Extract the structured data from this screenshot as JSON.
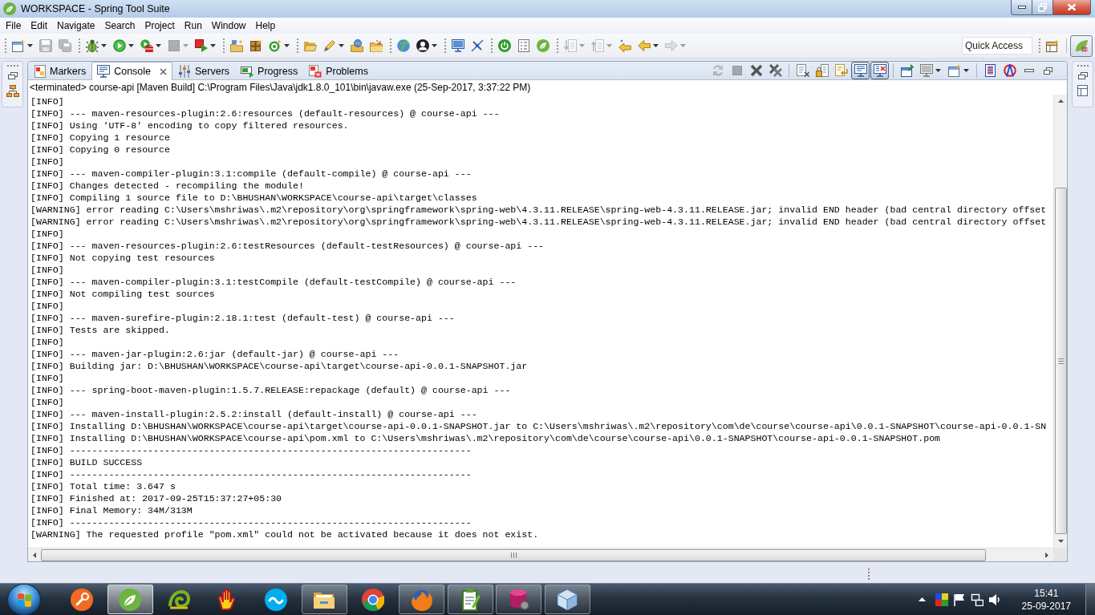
{
  "window": {
    "title": "WORKSPACE - Spring Tool Suite"
  },
  "menu": [
    {
      "label": "File"
    },
    {
      "label": "Edit"
    },
    {
      "label": "Navigate"
    },
    {
      "label": "Search"
    },
    {
      "label": "Project"
    },
    {
      "label": "Run"
    },
    {
      "label": "Window"
    },
    {
      "label": "Help"
    }
  ],
  "toolbar": {
    "buttons": [
      {
        "disabled": false
      },
      {
        "disabled": true
      },
      {
        "disabled": true
      },
      {
        "disabled": false
      },
      {
        "disabled": false
      },
      {
        "disabled": false
      },
      {
        "disabled": true
      },
      {
        "disabled": false
      },
      {
        "disabled": false
      },
      {
        "disabled": false
      },
      {
        "disabled": false
      },
      {
        "disabled": false
      },
      {
        "disabled": false
      },
      {
        "disabled": false
      },
      {
        "disabled": false
      },
      {
        "disabled": false
      },
      {
        "disabled": false
      },
      {
        "disabled": false
      },
      {
        "disabled": false
      },
      {
        "disabled": false
      },
      {
        "disabled": false
      },
      {
        "disabled": false
      },
      {
        "disabled": true
      },
      {
        "disabled": true
      },
      {
        "disabled": false
      },
      {
        "disabled": false
      },
      {
        "disabled": true
      }
    ],
    "quick_access": {
      "placeholder": "Quick Access"
    },
    "perspective": {
      "selected": true
    }
  },
  "view": {
    "tabs": [
      {
        "label": "Markers",
        "selected": false
      },
      {
        "label": "Console",
        "selected": true
      },
      {
        "label": "Servers",
        "selected": false
      },
      {
        "label": "Progress",
        "selected": false
      },
      {
        "label": "Problems",
        "selected": false
      }
    ],
    "toolbar": [
      {
        "disabled": true,
        "pressed": false
      },
      {
        "disabled": true,
        "pressed": false
      },
      {
        "disabled": false,
        "pressed": false
      },
      {
        "disabled": false,
        "pressed": false
      },
      {
        "disabled": false,
        "pressed": false
      },
      {
        "disabled": false,
        "pressed": false
      },
      {
        "disabled": false,
        "pressed": false
      },
      {
        "disabled": false,
        "pressed": true
      },
      {
        "disabled": false,
        "pressed": true
      },
      {
        "disabled": false,
        "pressed": false
      },
      {
        "disabled": false,
        "pressed": false
      },
      {
        "disabled": false,
        "pressed": false
      },
      {
        "disabled": false,
        "pressed": false
      },
      {
        "disabled": false,
        "pressed": false
      }
    ]
  },
  "console": {
    "description": "<terminated> course-api [Maven Build] C:\\Program Files\\Java\\jdk1.8.0_101\\bin\\javaw.exe (25-Sep-2017, 3:37:22 PM)",
    "lines": [
      "[INFO]",
      "[INFO] --- maven-resources-plugin:2.6:resources (default-resources) @ course-api ---",
      "[INFO] Using 'UTF-8' encoding to copy filtered resources.",
      "[INFO] Copying 1 resource",
      "[INFO] Copying 0 resource",
      "[INFO]",
      "[INFO] --- maven-compiler-plugin:3.1:compile (default-compile) @ course-api ---",
      "[INFO] Changes detected - recompiling the module!",
      "[INFO] Compiling 1 source file to D:\\BHUSHAN\\WORKSPACE\\course-api\\target\\classes",
      "[WARNING] error reading C:\\Users\\mshriwas\\.m2\\repository\\org\\springframework\\spring-web\\4.3.11.RELEASE\\spring-web-4.3.11.RELEASE.jar; invalid END header (bad central directory offset",
      "[WARNING] error reading C:\\Users\\mshriwas\\.m2\\repository\\org\\springframework\\spring-web\\4.3.11.RELEASE\\spring-web-4.3.11.RELEASE.jar; invalid END header (bad central directory offset",
      "[INFO]",
      "[INFO] --- maven-resources-plugin:2.6:testResources (default-testResources) @ course-api ---",
      "[INFO] Not copying test resources",
      "[INFO]",
      "[INFO] --- maven-compiler-plugin:3.1:testCompile (default-testCompile) @ course-api ---",
      "[INFO] Not compiling test sources",
      "[INFO]",
      "[INFO] --- maven-surefire-plugin:2.18.1:test (default-test) @ course-api ---",
      "[INFO] Tests are skipped.",
      "[INFO]",
      "[INFO] --- maven-jar-plugin:2.6:jar (default-jar) @ course-api ---",
      "[INFO] Building jar: D:\\BHUSHAN\\WORKSPACE\\course-api\\target\\course-api-0.0.1-SNAPSHOT.jar",
      "[INFO]",
      "[INFO] --- spring-boot-maven-plugin:1.5.7.RELEASE:repackage (default) @ course-api ---",
      "[INFO]",
      "[INFO] --- maven-install-plugin:2.5.2:install (default-install) @ course-api ---",
      "[INFO] Installing D:\\BHUSHAN\\WORKSPACE\\course-api\\target\\course-api-0.0.1-SNAPSHOT.jar to C:\\Users\\mshriwas\\.m2\\repository\\com\\de\\course\\course-api\\0.0.1-SNAPSHOT\\course-api-0.0.1-SN",
      "[INFO] Installing D:\\BHUSHAN\\WORKSPACE\\course-api\\pom.xml to C:\\Users\\mshriwas\\.m2\\repository\\com\\de\\course\\course-api\\0.0.1-SNAPSHOT\\course-api-0.0.1-SNAPSHOT.pom",
      "[INFO] ------------------------------------------------------------------------",
      "[INFO] BUILD SUCCESS",
      "[INFO] ------------------------------------------------------------------------",
      "[INFO] Total time: 3.647 s",
      "[INFO] Finished at: 2017-09-25T15:37:27+05:30",
      "[INFO] Final Memory: 34M/313M",
      "[INFO] ------------------------------------------------------------------------",
      "[WARNING] The requested profile \"pom.xml\" could not be activated because it does not exist."
    ]
  },
  "taskbar": {
    "apps": [
      {
        "running": false,
        "selected": false
      },
      {
        "running": true,
        "selected": true
      },
      {
        "running": false,
        "selected": false
      },
      {
        "running": false,
        "selected": false
      },
      {
        "running": false,
        "selected": false
      },
      {
        "running": true,
        "selected": false
      },
      {
        "running": false,
        "selected": false
      },
      {
        "running": true,
        "selected": false
      },
      {
        "running": true,
        "selected": false
      },
      {
        "running": true,
        "selected": false
      },
      {
        "running": true,
        "selected": false
      }
    ],
    "clock": {
      "time": "15:41",
      "date": "25-09-2017"
    }
  }
}
